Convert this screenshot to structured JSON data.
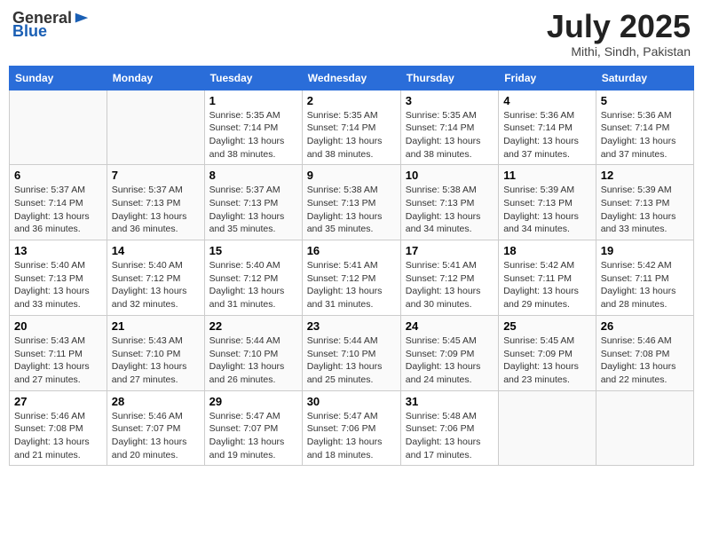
{
  "header": {
    "logo_general": "General",
    "logo_blue": "Blue",
    "title": "July 2025",
    "subtitle": "Mithi, Sindh, Pakistan"
  },
  "days_of_week": [
    "Sunday",
    "Monday",
    "Tuesday",
    "Wednesday",
    "Thursday",
    "Friday",
    "Saturday"
  ],
  "weeks": [
    [
      {
        "day": "",
        "info": ""
      },
      {
        "day": "",
        "info": ""
      },
      {
        "day": "1",
        "info": "Sunrise: 5:35 AM\nSunset: 7:14 PM\nDaylight: 13 hours and 38 minutes."
      },
      {
        "day": "2",
        "info": "Sunrise: 5:35 AM\nSunset: 7:14 PM\nDaylight: 13 hours and 38 minutes."
      },
      {
        "day": "3",
        "info": "Sunrise: 5:35 AM\nSunset: 7:14 PM\nDaylight: 13 hours and 38 minutes."
      },
      {
        "day": "4",
        "info": "Sunrise: 5:36 AM\nSunset: 7:14 PM\nDaylight: 13 hours and 37 minutes."
      },
      {
        "day": "5",
        "info": "Sunrise: 5:36 AM\nSunset: 7:14 PM\nDaylight: 13 hours and 37 minutes."
      }
    ],
    [
      {
        "day": "6",
        "info": "Sunrise: 5:37 AM\nSunset: 7:14 PM\nDaylight: 13 hours and 36 minutes."
      },
      {
        "day": "7",
        "info": "Sunrise: 5:37 AM\nSunset: 7:13 PM\nDaylight: 13 hours and 36 minutes."
      },
      {
        "day": "8",
        "info": "Sunrise: 5:37 AM\nSunset: 7:13 PM\nDaylight: 13 hours and 35 minutes."
      },
      {
        "day": "9",
        "info": "Sunrise: 5:38 AM\nSunset: 7:13 PM\nDaylight: 13 hours and 35 minutes."
      },
      {
        "day": "10",
        "info": "Sunrise: 5:38 AM\nSunset: 7:13 PM\nDaylight: 13 hours and 34 minutes."
      },
      {
        "day": "11",
        "info": "Sunrise: 5:39 AM\nSunset: 7:13 PM\nDaylight: 13 hours and 34 minutes."
      },
      {
        "day": "12",
        "info": "Sunrise: 5:39 AM\nSunset: 7:13 PM\nDaylight: 13 hours and 33 minutes."
      }
    ],
    [
      {
        "day": "13",
        "info": "Sunrise: 5:40 AM\nSunset: 7:13 PM\nDaylight: 13 hours and 33 minutes."
      },
      {
        "day": "14",
        "info": "Sunrise: 5:40 AM\nSunset: 7:12 PM\nDaylight: 13 hours and 32 minutes."
      },
      {
        "day": "15",
        "info": "Sunrise: 5:40 AM\nSunset: 7:12 PM\nDaylight: 13 hours and 31 minutes."
      },
      {
        "day": "16",
        "info": "Sunrise: 5:41 AM\nSunset: 7:12 PM\nDaylight: 13 hours and 31 minutes."
      },
      {
        "day": "17",
        "info": "Sunrise: 5:41 AM\nSunset: 7:12 PM\nDaylight: 13 hours and 30 minutes."
      },
      {
        "day": "18",
        "info": "Sunrise: 5:42 AM\nSunset: 7:11 PM\nDaylight: 13 hours and 29 minutes."
      },
      {
        "day": "19",
        "info": "Sunrise: 5:42 AM\nSunset: 7:11 PM\nDaylight: 13 hours and 28 minutes."
      }
    ],
    [
      {
        "day": "20",
        "info": "Sunrise: 5:43 AM\nSunset: 7:11 PM\nDaylight: 13 hours and 27 minutes."
      },
      {
        "day": "21",
        "info": "Sunrise: 5:43 AM\nSunset: 7:10 PM\nDaylight: 13 hours and 27 minutes."
      },
      {
        "day": "22",
        "info": "Sunrise: 5:44 AM\nSunset: 7:10 PM\nDaylight: 13 hours and 26 minutes."
      },
      {
        "day": "23",
        "info": "Sunrise: 5:44 AM\nSunset: 7:10 PM\nDaylight: 13 hours and 25 minutes."
      },
      {
        "day": "24",
        "info": "Sunrise: 5:45 AM\nSunset: 7:09 PM\nDaylight: 13 hours and 24 minutes."
      },
      {
        "day": "25",
        "info": "Sunrise: 5:45 AM\nSunset: 7:09 PM\nDaylight: 13 hours and 23 minutes."
      },
      {
        "day": "26",
        "info": "Sunrise: 5:46 AM\nSunset: 7:08 PM\nDaylight: 13 hours and 22 minutes."
      }
    ],
    [
      {
        "day": "27",
        "info": "Sunrise: 5:46 AM\nSunset: 7:08 PM\nDaylight: 13 hours and 21 minutes."
      },
      {
        "day": "28",
        "info": "Sunrise: 5:46 AM\nSunset: 7:07 PM\nDaylight: 13 hours and 20 minutes."
      },
      {
        "day": "29",
        "info": "Sunrise: 5:47 AM\nSunset: 7:07 PM\nDaylight: 13 hours and 19 minutes."
      },
      {
        "day": "30",
        "info": "Sunrise: 5:47 AM\nSunset: 7:06 PM\nDaylight: 13 hours and 18 minutes."
      },
      {
        "day": "31",
        "info": "Sunrise: 5:48 AM\nSunset: 7:06 PM\nDaylight: 13 hours and 17 minutes."
      },
      {
        "day": "",
        "info": ""
      },
      {
        "day": "",
        "info": ""
      }
    ]
  ]
}
